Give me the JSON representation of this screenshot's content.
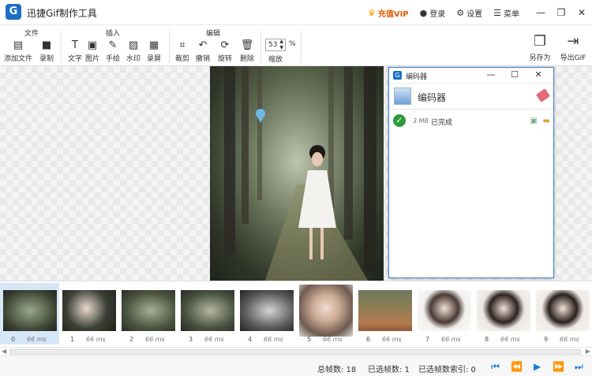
{
  "app": {
    "title": "迅捷Gif制作工具",
    "logo_letter": "G"
  },
  "header": {
    "vip_label": "充值VIP",
    "login_label": "登录",
    "settings_label": "设置",
    "menu_label": "菜单"
  },
  "toolbar": {
    "groups": {
      "file": "文件",
      "insert": "插入",
      "edit": "编辑"
    },
    "tools": {
      "add_file": "添加文件",
      "record": "录制",
      "text": "文字",
      "image": "图片",
      "draw": "手绘",
      "watermark": "水印",
      "screen_record": "录屏",
      "crop": "裁剪",
      "undo": "撤销",
      "rotate": "旋转",
      "delete": "删除",
      "zoom_label": "缩放",
      "zoom_value": "53",
      "zoom_unit": "%",
      "save_as": "另存为",
      "export_gif": "导出GIF"
    }
  },
  "encoder": {
    "window_title": "编码器",
    "heading": "编码器",
    "items": [
      {
        "size": "3 MB",
        "status": "已完成"
      }
    ]
  },
  "frames": [
    {
      "index": "0",
      "duration": "66 ms",
      "selected": true
    },
    {
      "index": "1",
      "duration": "66 ms"
    },
    {
      "index": "2",
      "duration": "66 ms"
    },
    {
      "index": "3",
      "duration": "66 ms"
    },
    {
      "index": "4",
      "duration": "66 ms"
    },
    {
      "index": "5",
      "duration": "66 ms"
    },
    {
      "index": "6",
      "duration": "66 ms"
    },
    {
      "index": "7",
      "duration": "66 ms"
    },
    {
      "index": "8",
      "duration": "66 ms"
    },
    {
      "index": "9",
      "duration": "66 ms"
    },
    {
      "index": "10",
      "duration": ""
    }
  ],
  "status": {
    "total_frames": "总帧数: 18",
    "selected_frames": "已选帧数: 1",
    "selected_index": "已选帧数索引: 0"
  },
  "colors": {
    "accent": "#1e7fd6",
    "vip": "#e05a00",
    "encoder_border": "#3c7fd1"
  }
}
